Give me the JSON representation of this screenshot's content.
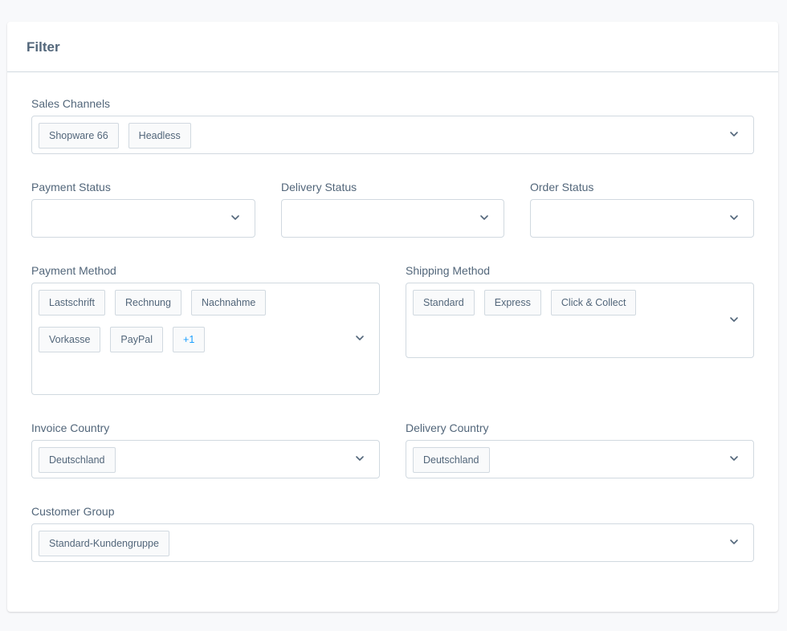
{
  "card": {
    "title": "Filter"
  },
  "sales_channels": {
    "label": "Sales Channels",
    "tags": [
      "Shopware 66",
      "Headless"
    ]
  },
  "payment_status": {
    "label": "Payment Status",
    "tags": []
  },
  "delivery_status": {
    "label": "Delivery Status",
    "tags": []
  },
  "order_status": {
    "label": "Order Status",
    "tags": []
  },
  "payment_method": {
    "label": "Payment Method",
    "tags": [
      "Lastschrift",
      "Rechnung",
      "Nachnahme",
      "Vorkasse",
      "PayPal"
    ],
    "more": "+1"
  },
  "shipping_method": {
    "label": "Shipping Method",
    "tags": [
      "Standard",
      "Express",
      "Click & Collect"
    ]
  },
  "invoice_country": {
    "label": "Invoice Country",
    "tags": [
      "Deutschland"
    ]
  },
  "delivery_country": {
    "label": "Delivery Country",
    "tags": [
      "Deutschland"
    ]
  },
  "customer_group": {
    "label": "Customer Group",
    "tags": [
      "Standard-Kundengruppe"
    ]
  },
  "colors": {
    "accent": "#189eff",
    "border": "#d1d9e0",
    "text": "#52667a"
  },
  "icons": {
    "dropdown": "chevron-down-icon"
  }
}
